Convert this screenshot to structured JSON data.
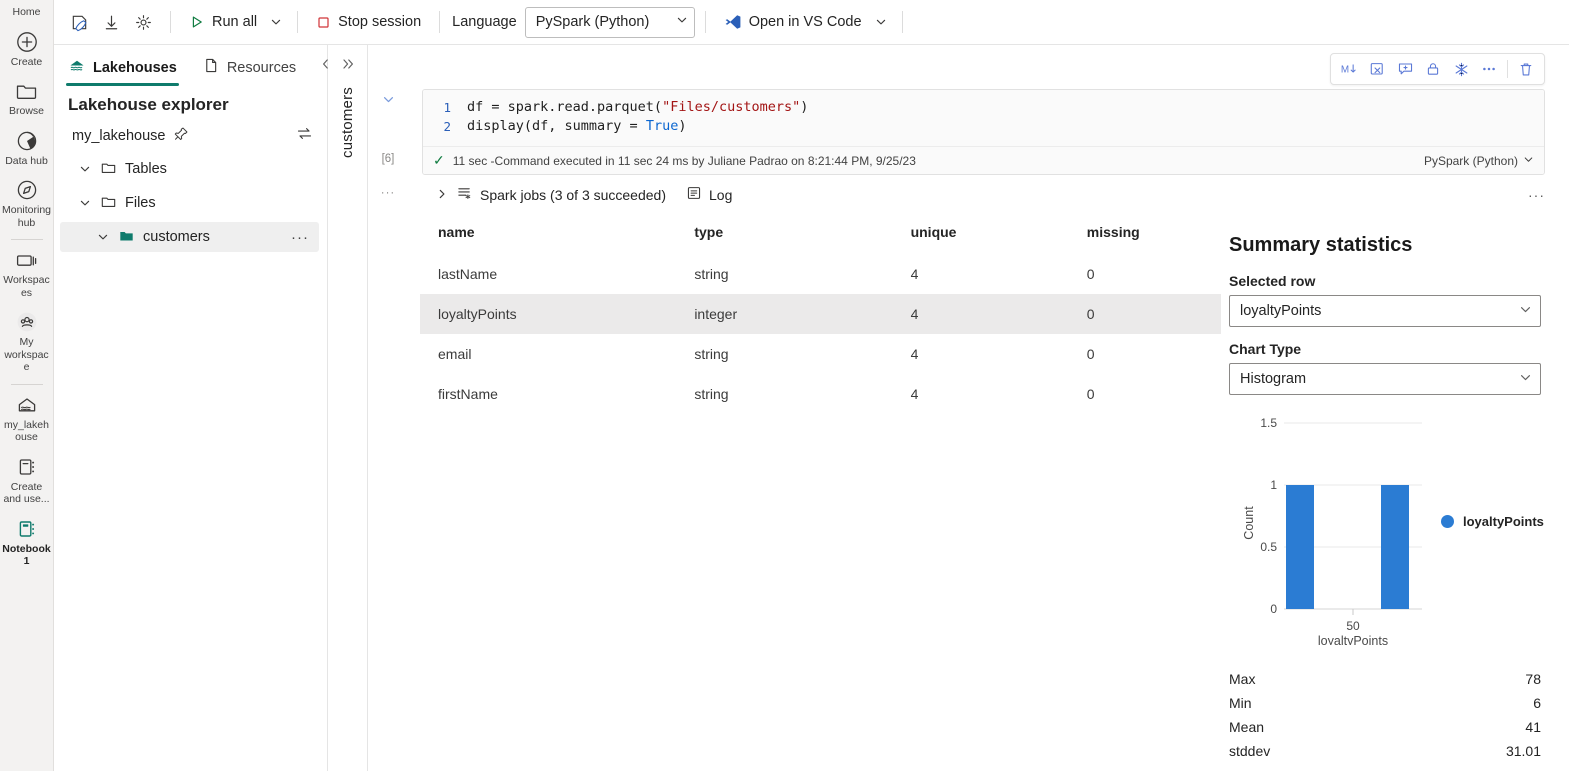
{
  "rail": {
    "home_label": "Home",
    "items": [
      {
        "label": "Create",
        "icon": "plus-circle-icon",
        "active": false
      },
      {
        "label": "Browse",
        "icon": "folder-icon",
        "active": false
      },
      {
        "label": "Data hub",
        "icon": "data-hub-icon",
        "active": false
      },
      {
        "label": "Monitoring hub",
        "icon": "monitoring-hub-icon",
        "active": false
      },
      {
        "label": "Workspaces",
        "icon": "workspaces-icon",
        "active": false
      },
      {
        "label": "My workspace",
        "icon": "my-workspace-icon",
        "active": false
      },
      {
        "label": "my_lakehouse",
        "icon": "lakehouse-icon",
        "active": false
      },
      {
        "label": "Create and use...",
        "icon": "notebook-icon",
        "active": false
      },
      {
        "label": "Notebook 1",
        "icon": "notebook-green-icon",
        "active": true
      }
    ]
  },
  "toolbar": {
    "icons": [
      "save-icon",
      "download-icon",
      "settings-icon"
    ],
    "run_all_label": "Run all",
    "stop_session_label": "Stop session",
    "language_label": "Language",
    "language_value": "PySpark (Python)",
    "open_vscode_label": "Open in VS Code"
  },
  "explorer": {
    "tabs": [
      {
        "label": "Lakehouses",
        "icon": "lakehouse-icon",
        "active": true
      },
      {
        "label": "Resources",
        "icon": "file-icon",
        "active": false
      }
    ],
    "collapse_icon": "chevron-double-left-icon",
    "title": "Lakehouse explorer",
    "lakehouse_name": "my_lakehouse",
    "pin_icon": "pin-icon",
    "switch_icon": "switch-icon",
    "tree": [
      {
        "label": "Tables",
        "icon": "folder-icon",
        "selected": false,
        "indent": false,
        "more": false
      },
      {
        "label": "Files",
        "icon": "folder-icon",
        "selected": false,
        "indent": false,
        "more": false
      },
      {
        "label": "customers",
        "icon": "folder-filled-icon",
        "selected": true,
        "indent": true,
        "more": true
      }
    ],
    "more_glyph": "···"
  },
  "vstrip": {
    "expand_icon": "chevron-double-right-icon",
    "tab_label": "customers"
  },
  "notebook": {
    "gutter": {
      "collapse_icon": "chevron-down-icon",
      "exec_count": "[6]",
      "more_glyph": "···"
    },
    "cell_toolbar_icons": [
      "markdown-icon",
      "clear-output-icon",
      "add-comment-icon",
      "lock-icon",
      "freeze-icon",
      "more-icon",
      "delete-icon"
    ],
    "code": {
      "lines": [
        {
          "no": "1",
          "segments": [
            {
              "t": "df = spark.read.parquet(",
              "c": "plain"
            },
            {
              "t": "\"Files/customers\"",
              "c": "str"
            },
            {
              "t": ")",
              "c": "plain"
            }
          ]
        },
        {
          "no": "2",
          "segments": [
            {
              "t": "display(df, summary = ",
              "c": "plain"
            },
            {
              "t": "True",
              "c": "kw"
            },
            {
              "t": ")",
              "c": "plain"
            }
          ]
        }
      ]
    },
    "status": {
      "check_icon": "check-icon",
      "text": "11 sec -Command executed in 11 sec 24 ms by Juliane Padrao on 8:21:44 PM, 9/25/23",
      "kernel": "PySpark (Python)"
    },
    "spark": {
      "expand_icon": "chevron-right-icon",
      "jobs_icon": "spark-jobs-icon",
      "jobs_label": "Spark jobs (3 of 3 succeeded)",
      "log_icon": "log-icon",
      "log_label": "Log",
      "more_glyph": "···"
    }
  },
  "table": {
    "headers": [
      "name",
      "type",
      "unique",
      "missing"
    ],
    "rows": [
      {
        "name": "lastName",
        "type": "string",
        "unique": "4",
        "missing": "0",
        "highlight": false
      },
      {
        "name": "loyaltyPoints",
        "type": "integer",
        "unique": "4",
        "missing": "0",
        "highlight": true
      },
      {
        "name": "email",
        "type": "string",
        "unique": "4",
        "missing": "0",
        "highlight": false
      },
      {
        "name": "firstName",
        "type": "string",
        "unique": "4",
        "missing": "0",
        "highlight": false
      }
    ]
  },
  "summary": {
    "title": "Summary statistics",
    "selected_row_label": "Selected row",
    "selected_row_value": "loyaltyPoints",
    "chart_type_label": "Chart Type",
    "chart_type_value": "Histogram",
    "caret_icon": "chevron-down-icon",
    "stats": [
      {
        "key": "Max",
        "value": "78"
      },
      {
        "key": "Min",
        "value": "6"
      },
      {
        "key": "Mean",
        "value": "41"
      },
      {
        "key": "stddev",
        "value": "31.01"
      }
    ]
  },
  "chart_data": {
    "type": "bar",
    "title": "",
    "xlabel": "loyaltyPoints",
    "ylabel": "Count",
    "categories": [
      "bin-low",
      "bin-high"
    ],
    "values": [
      1,
      1
    ],
    "x_ticks": [
      "50"
    ],
    "y_ticks": [
      "0",
      "0.5",
      "1",
      "1.5"
    ],
    "ylim": [
      0,
      1.5
    ],
    "grid": true,
    "legend": [
      {
        "name": "loyaltyPoints",
        "color": "#2b7cd3"
      }
    ],
    "legend_position": "right",
    "bar_color": "#2b7cd3"
  },
  "colors": {
    "accent_green": "#0f7b6c",
    "bar_blue": "#2b7cd3",
    "toolbar_blue": "#5b79d6",
    "run_green": "#107c41",
    "stop_red": "#d13438"
  }
}
